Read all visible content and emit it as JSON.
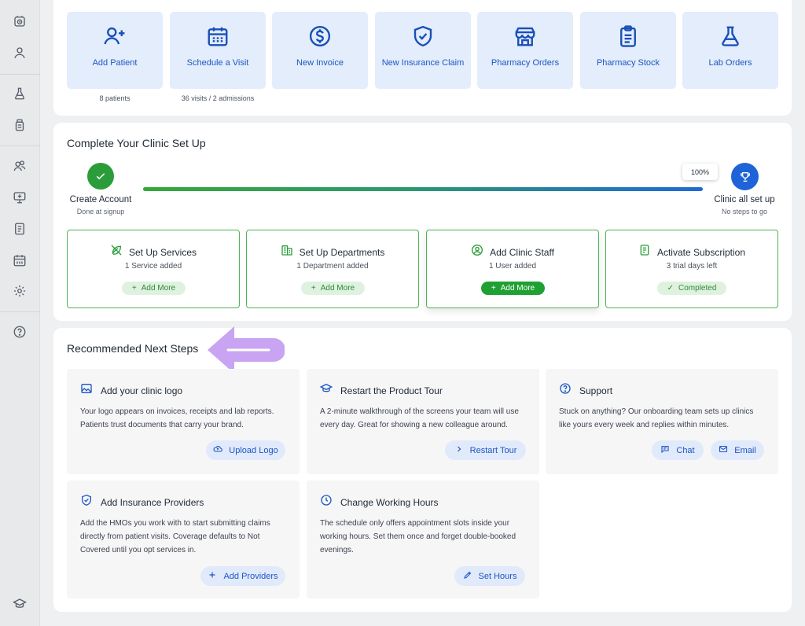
{
  "sidebar": {
    "icons": [
      "dashboard-icon",
      "user-icon",
      "lab-flask-icon",
      "pharmacy-bottle-icon",
      "staff-group-icon",
      "monitor-icon",
      "document-icon",
      "calendar-icon",
      "settings-icon",
      "help-icon",
      "graduation-cap-icon"
    ]
  },
  "quick_actions": [
    {
      "label": "Add Patient",
      "icon": "add-user-icon",
      "sub": "8 patients"
    },
    {
      "label": "Schedule a Visit",
      "icon": "calendar-icon",
      "sub": "36 visits / 2 admissions"
    },
    {
      "label": "New Invoice",
      "icon": "dollar-icon",
      "sub": ""
    },
    {
      "label": "New Insurance Claim",
      "icon": "shield-check-icon",
      "sub": ""
    },
    {
      "label": "Pharmacy Orders",
      "icon": "store-icon",
      "sub": ""
    },
    {
      "label": "Pharmacy Stock",
      "icon": "clipboard-icon",
      "sub": ""
    },
    {
      "label": "Lab Orders",
      "icon": "flask-icon",
      "sub": ""
    }
  ],
  "setup": {
    "title": "Complete Your Clinic Set Up",
    "start": {
      "title": "Create Account",
      "sub": "Done at signup"
    },
    "end": {
      "title": "Clinic all set up",
      "sub": "No steps to go"
    },
    "progress_label": "100%",
    "progress": 1.0,
    "colors": {
      "green": "#2a9d3a",
      "blue": "#1f63d9"
    },
    "steps": [
      {
        "title": "Set Up Services",
        "sub": "1 Service added",
        "action": "Add More",
        "icon": "no-service-icon",
        "style": "light"
      },
      {
        "title": "Set Up Departments",
        "sub": "1 Department added",
        "action": "Add More",
        "icon": "building-icon",
        "style": "light"
      },
      {
        "title": "Add Clinic Staff",
        "sub": "1 User added",
        "action": "Add More",
        "icon": "user-circle-icon",
        "style": "solid"
      },
      {
        "title": "Activate Subscription",
        "sub": "3 trial days left",
        "action": "Completed",
        "icon": "receipt-icon",
        "style": "done"
      }
    ]
  },
  "next": {
    "title": "Recommended Next Steps",
    "cards": [
      {
        "title": "Add your clinic logo",
        "icon": "image-icon",
        "body": "Your logo appears on invoices, receipts and lab reports. Patients trust documents that carry your brand.",
        "buttons": [
          {
            "label": "Upload Logo",
            "icon": "cloud-upload-icon"
          }
        ]
      },
      {
        "title": "Restart the Product Tour",
        "icon": "graduation-cap-icon",
        "body": "A 2-minute walkthrough of the screens your team will use every day. Great for showing a new colleague around.",
        "buttons": [
          {
            "label": "Restart Tour",
            "icon": "chevron-right-icon"
          }
        ]
      },
      {
        "title": "Support",
        "icon": "help-icon",
        "body": "Stuck on anything? Our onboarding team sets up clinics like yours every week and replies within minutes.",
        "buttons": [
          {
            "label": "Chat",
            "icon": "chat-icon"
          },
          {
            "label": "Email",
            "icon": "mail-icon"
          }
        ]
      },
      {
        "title": "Add Insurance Providers",
        "icon": "shield-check-icon",
        "body": "Add the HMOs you work with to start submitting claims directly from patient visits. Coverage defaults to Not Covered until you opt services in.",
        "buttons": [
          {
            "label": "Add Providers",
            "icon": "plus-icon"
          }
        ]
      },
      {
        "title": "Change Working Hours",
        "icon": "clock-icon",
        "body": "The schedule only offers appointment slots inside your working hours. Set them once and forget double-booked evenings.",
        "buttons": [
          {
            "label": "Set Hours",
            "icon": "pencil-icon"
          }
        ]
      }
    ]
  }
}
